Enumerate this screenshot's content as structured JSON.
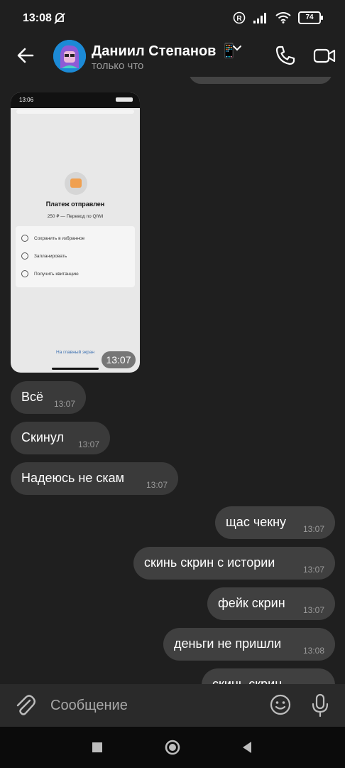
{
  "status_bar": {
    "time": "13:08",
    "battery": "74"
  },
  "header": {
    "contact_name": "Даниил Степанов 📱",
    "contact_status": "только что"
  },
  "attachment": {
    "phone_time": "13:06",
    "payment_title": "Платеж отправлен",
    "payment_subtitle": "250 ₽ — Перевод по QIWI",
    "options": [
      "Сохранить в избранное",
      "Запланировать",
      "Получить квитанцию"
    ],
    "link": "На главный экран",
    "time": "13:07"
  },
  "messages": [
    {
      "direction": "in",
      "text": "Всё",
      "time": "13:07"
    },
    {
      "direction": "in",
      "text": "Скинул",
      "time": "13:07"
    },
    {
      "direction": "in",
      "text": "Надеюсь не скам",
      "time": "13:07"
    },
    {
      "direction": "out",
      "text": "щас чекну",
      "time": "13:07"
    },
    {
      "direction": "out",
      "text": "скинь скрин с истории",
      "time": "13:07"
    },
    {
      "direction": "out",
      "text": "фейк скрин",
      "time": "13:07"
    },
    {
      "direction": "out",
      "text": "деньги не пришли",
      "time": "13:08"
    },
    {
      "direction": "out",
      "text": "скинь скрин",
      "time": ""
    }
  ],
  "composer": {
    "placeholder": "Сообщение"
  }
}
